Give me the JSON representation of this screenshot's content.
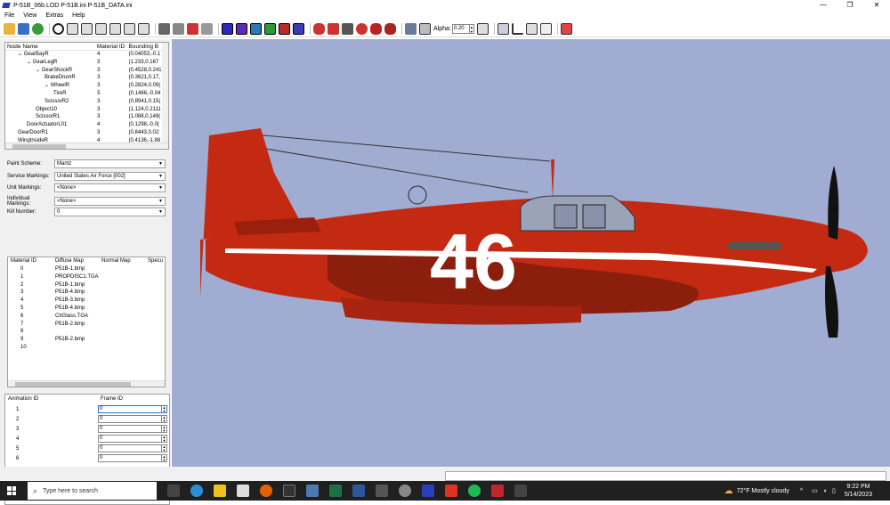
{
  "window": {
    "title": "P-51B_06b.LOD  P-51B.ini  P-51B_DATA.ini",
    "minimize": "—",
    "maximize": "❐",
    "close": "✕"
  },
  "menu": [
    "File",
    "View",
    "Extras",
    "Help"
  ],
  "toolbar": {
    "alpha_label": "Alpha:",
    "alpha_value": "0.20"
  },
  "tree": {
    "columns": [
      "Node Name",
      "Material ID",
      "Bounding B"
    ],
    "rows": [
      {
        "name": "GearBayR",
        "indent": 1,
        "expanded": true,
        "material": "4",
        "bounds": "(0.04053,-0.1"
      },
      {
        "name": "GearLegR",
        "indent": 2,
        "expanded": true,
        "material": "3",
        "bounds": "(1.233,0.167"
      },
      {
        "name": "GearShockR",
        "indent": 3,
        "expanded": true,
        "material": "3",
        "bounds": "(0.4528,0.241"
      },
      {
        "name": "BrakeDrumR",
        "indent": 4,
        "expanded": false,
        "material": "3",
        "bounds": "(0.3621,0.17,"
      },
      {
        "name": "WheelR",
        "indent": 4,
        "expanded": true,
        "material": "3",
        "bounds": "(0.2824,0.09("
      },
      {
        "name": "TireR",
        "indent": 5,
        "expanded": false,
        "material": "5",
        "bounds": "(0.1466,-0.04"
      },
      {
        "name": "ScissorR2",
        "indent": 4,
        "expanded": false,
        "material": "3",
        "bounds": "(0.8941,0.15("
      },
      {
        "name": "Object10",
        "indent": 3,
        "expanded": false,
        "material": "3",
        "bounds": "(1.124,0.2111"
      },
      {
        "name": "ScissorR1",
        "indent": 3,
        "expanded": false,
        "material": "3",
        "bounds": "(1.088,0.149("
      },
      {
        "name": "DoorActuatorL01",
        "indent": 2,
        "expanded": false,
        "material": "4",
        "bounds": "(0.1298,-0.0("
      },
      {
        "name": "GearDoorR1",
        "indent": 1,
        "expanded": false,
        "material": "3",
        "bounds": "(0.8443,0.02:"
      },
      {
        "name": "WingInsideR",
        "indent": 1,
        "expanded": false,
        "material": "4",
        "bounds": "(0.4136,-1.88"
      }
    ]
  },
  "form": [
    {
      "label": "Paint Scheme:",
      "value": "Mantz"
    },
    {
      "label": "Service Markings:",
      "value": "United States Air Force [002]"
    },
    {
      "label": "Unit Markings:",
      "value": "<None>"
    },
    {
      "label": "Individual Markings:",
      "value": "<None>"
    },
    {
      "label": "Kill Number:",
      "value": "0"
    }
  ],
  "materials": {
    "columns": [
      "Material ID",
      "Diffuse Map",
      "Normal Map",
      "Specu"
    ],
    "rows": [
      {
        "id": "0",
        "diffuse": "P51B-1.bmp"
      },
      {
        "id": "1",
        "diffuse": "PROPDISC1.TGA"
      },
      {
        "id": "2",
        "diffuse": "P51B-1.bmp"
      },
      {
        "id": "3",
        "diffuse": "P51B-4.bmp"
      },
      {
        "id": "4",
        "diffuse": "P51B-3.bmp"
      },
      {
        "id": "5",
        "diffuse": "P51B-4.bmp"
      },
      {
        "id": "6",
        "diffuse": "ClrGlass.TGA"
      },
      {
        "id": "7",
        "diffuse": "P51B-2.bmp"
      },
      {
        "id": "8",
        "diffuse": ""
      },
      {
        "id": "9",
        "diffuse": "P51B-2.bmp"
      },
      {
        "id": "10",
        "diffuse": ""
      }
    ]
  },
  "animation": {
    "columns": [
      "Animation ID",
      "Frame ID"
    ],
    "rows": [
      {
        "id": "1",
        "frame": "0"
      },
      {
        "id": "2",
        "frame": "0"
      },
      {
        "id": "3",
        "frame": "0"
      },
      {
        "id": "4",
        "frame": "0"
      },
      {
        "id": "5",
        "frame": "0"
      },
      {
        "id": "6",
        "frame": "0"
      }
    ]
  },
  "viewport": {
    "race_number": "46",
    "background_color": "#a1acd2",
    "fuselage_color": "#c42a12"
  },
  "taskbar": {
    "search_placeholder": "Type here to search",
    "weather": "72°F  Mostly cloudy",
    "time": "9:22 PM",
    "date": "5/14/2023"
  }
}
